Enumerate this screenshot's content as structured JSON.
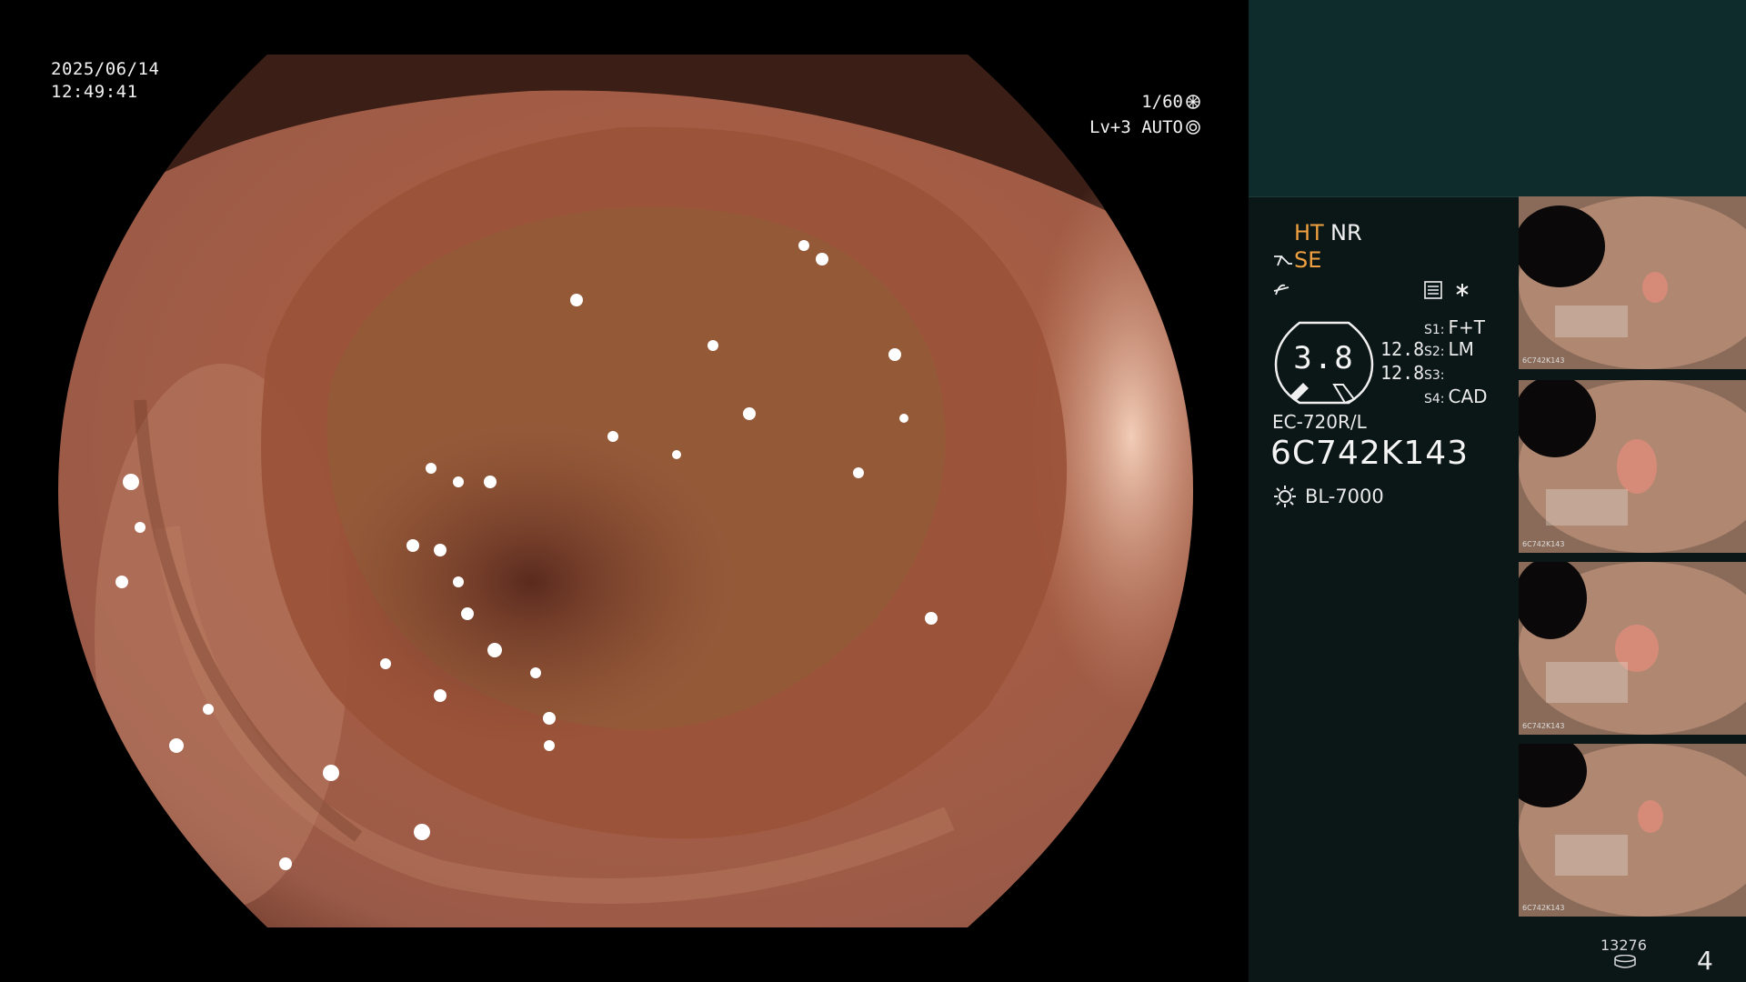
{
  "osd": {
    "date": "2025/06/14",
    "time": "12:49:41",
    "shutter": "1/60",
    "level": "Lv+3 AUTO"
  },
  "panel": {
    "mode1": "HT",
    "mode2": "NR",
    "mode3": "SE",
    "gauge_value": "3.8",
    "side_value_1": "12.8",
    "side_value_2": "12.8",
    "settings": [
      {
        "key": "S1:",
        "value": "F+T"
      },
      {
        "key": "S2:",
        "value": "LM"
      },
      {
        "key": "S3:",
        "value": ""
      },
      {
        "key": "S4:",
        "value": "CAD"
      }
    ],
    "scope_model": "EC-720R/L",
    "serial": "6C742K143",
    "light_source": "BL-7000",
    "counter": "13276",
    "page": "4"
  },
  "thumbnails": [
    {
      "caption": "6C742K143"
    },
    {
      "caption": "6C742K143"
    },
    {
      "caption": "6C742K143"
    },
    {
      "caption": "6C742K143"
    }
  ],
  "colors": {
    "accent": "#f0a040",
    "panel_bg": "#0b1716",
    "top_box": "#0f2c2c"
  }
}
